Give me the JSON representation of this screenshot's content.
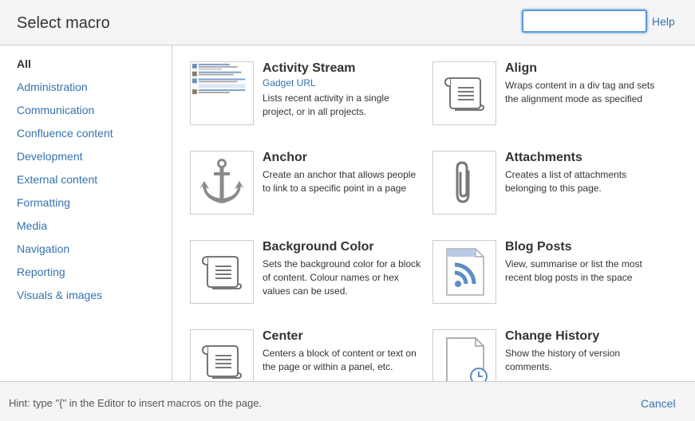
{
  "dialog": {
    "title": "Select macro",
    "search": {
      "value": "",
      "placeholder": ""
    },
    "help_label": "Help"
  },
  "sidebar": {
    "categories": [
      {
        "label": "All",
        "active": true
      },
      {
        "label": "Administration"
      },
      {
        "label": "Communication"
      },
      {
        "label": "Confluence content"
      },
      {
        "label": "Development"
      },
      {
        "label": "External content"
      },
      {
        "label": "Formatting"
      },
      {
        "label": "Media"
      },
      {
        "label": "Navigation"
      },
      {
        "label": "Reporting"
      },
      {
        "label": "Visuals & images"
      }
    ]
  },
  "macros": [
    {
      "name": "Activity Stream",
      "subtitle": "Gadget URL",
      "description": "Lists recent activity in a single project, or in all projects.",
      "icon": "activity-stream-preview"
    },
    {
      "name": "Align",
      "description": "Wraps content in a div tag and sets the alignment mode as specified",
      "icon": "scroll-icon"
    },
    {
      "name": "Anchor",
      "description": "Create an anchor that allows people to link to a specific point in a page",
      "icon": "anchor-icon"
    },
    {
      "name": "Attachments",
      "description": "Creates a list of attachments belonging to this page.",
      "icon": "paperclip-icon"
    },
    {
      "name": "Background Color",
      "description": "Sets the background color for a block of content. Colour names or hex values can be used.",
      "icon": "scroll-icon"
    },
    {
      "name": "Blog Posts",
      "description": "View, summarise or list the most recent blog posts in the space",
      "icon": "rss-document-icon"
    },
    {
      "name": "Center",
      "description": "Centers a block of content or text on the page or within a panel, etc.",
      "icon": "scroll-icon"
    },
    {
      "name": "Change History",
      "description": "Show the history of version comments.",
      "icon": "clock-document-icon"
    }
  ],
  "footer": {
    "hint": "Hint: type \"{\" in the Editor to insert macros on the page.",
    "cancel_label": "Cancel"
  },
  "colors": {
    "link": "#3572b0",
    "focus": "#5b9ad5",
    "rss": "#5b8ec4"
  }
}
